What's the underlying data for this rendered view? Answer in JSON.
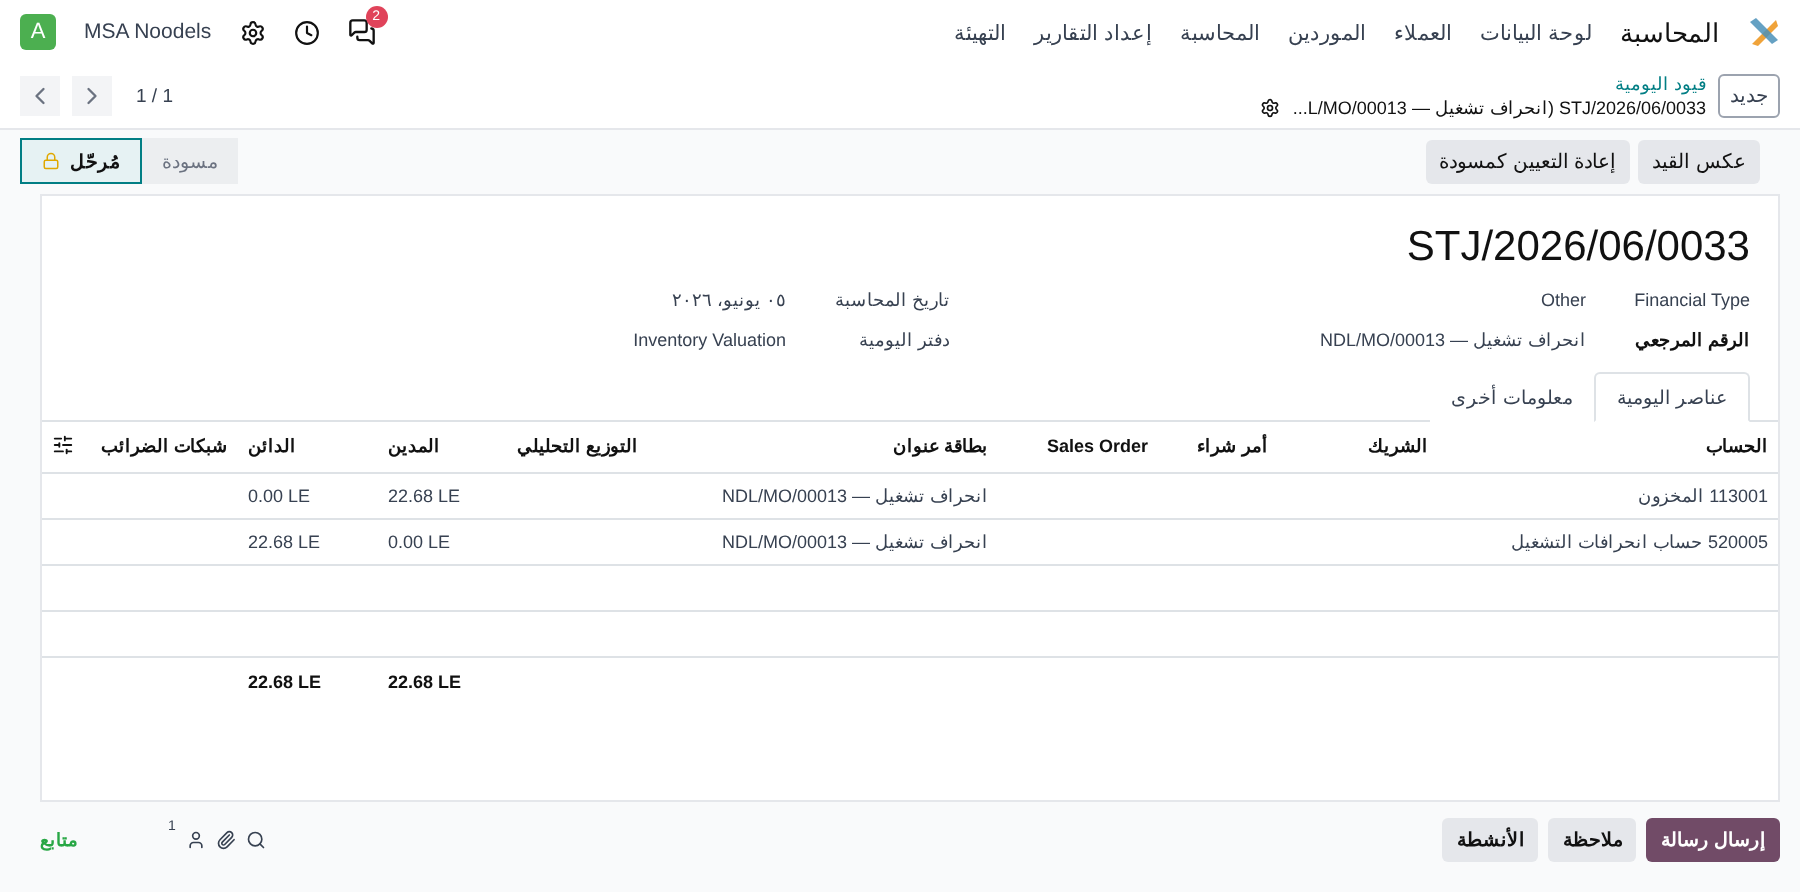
{
  "navbar": {
    "app_name": "المحاسبة",
    "menu": [
      "لوحة البيانات",
      "العملاء",
      "الموردين",
      "المحاسبة",
      "إعداد التقارير",
      "التهيئة"
    ],
    "company": "MSA Noodels",
    "avatar": "A",
    "chat_badge": "2"
  },
  "control_panel": {
    "new_button": "جديد",
    "breadcrumb": "قيود اليومية",
    "record": "STJ/2026/06/0033 (انحراف تشغيل — L/MO/00013...",
    "pager": "1 / 1"
  },
  "actions": [
    "عكس القيد",
    "إعادة التعيين كمسودة"
  ],
  "statuses": [
    {
      "label": "مسودة",
      "selected": false
    },
    {
      "label": "مُرحّل",
      "selected": true
    }
  ],
  "form": {
    "title": "STJ/2026/06/0033",
    "fields_right": [
      {
        "label": "Financial Type",
        "value": "Other",
        "bold": false
      },
      {
        "label": "الرقم المرجعي",
        "value": "انحراف تشغيل — NDL/MO/00013",
        "bold": true
      }
    ],
    "fields_left": [
      {
        "label": "تاريخ المحاسبة",
        "value": "٠٥ يونيو، ٢٠٢٦"
      },
      {
        "label": "دفتر اليومية",
        "value": "Inventory Valuation"
      }
    ],
    "tabs": [
      {
        "label": "عناصر اليومية",
        "selected": true
      },
      {
        "label": "معلومات أخرى",
        "selected": false
      }
    ]
  },
  "table": {
    "columns": [
      "الحساب",
      "الشريك",
      "أمر شراء",
      "Sales Order",
      "بطاقة عنوان",
      "التوزيع التحليلي",
      "المدين",
      "الدائن",
      "شبكات الضرائب"
    ],
    "rows": [
      [
        "113001 المخزون",
        "",
        "",
        "",
        "انحراف تشغيل — NDL/MO/00013",
        "",
        "22.68 LE",
        "0.00 LE",
        ""
      ],
      [
        "520005 حساب انحرافات التشغيل",
        "",
        "",
        "",
        "انحراف تشغيل — NDL/MO/00013",
        "",
        "0.00 LE",
        "22.68 LE",
        ""
      ]
    ],
    "totals": {
      "debit": "22.68 LE",
      "credit": "22.68 LE"
    }
  },
  "chatter": {
    "buttons": [
      {
        "label": "إرسال رسالة",
        "primary": true
      },
      {
        "label": "ملاحظة",
        "primary": false
      },
      {
        "label": "الأنشطة",
        "primary": false
      }
    ],
    "followers_count": "1",
    "follow": "متابع"
  }
}
